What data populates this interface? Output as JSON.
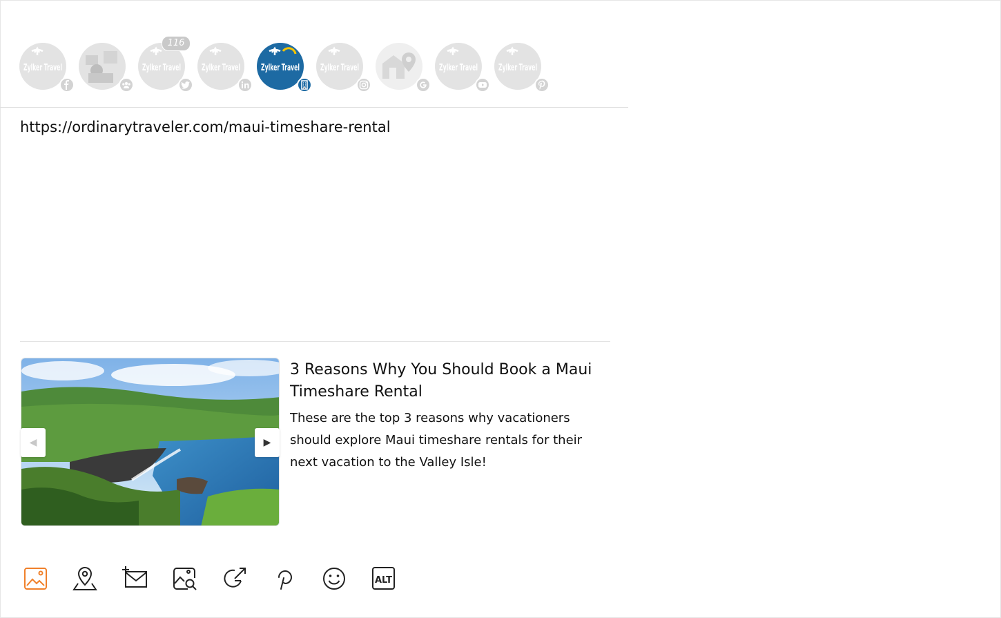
{
  "profiles": [
    {
      "name": "Zylker Travel",
      "network": "facebook",
      "network_icon": "facebook-icon",
      "active": false
    },
    {
      "name": "Zylker Travel",
      "network": "facebook-group",
      "network_icon": "group-icon",
      "active": false
    },
    {
      "name": "Zylker Travel",
      "network": "twitter",
      "network_icon": "twitter-icon",
      "active": false,
      "count": "116"
    },
    {
      "name": "Zylker Travel",
      "network": "linkedin",
      "network_icon": "linkedin-icon",
      "active": false
    },
    {
      "name": "Zylker Travel",
      "network": "linkedin-page",
      "network_icon": "building-icon",
      "active": true
    },
    {
      "name": "Zylker Travel",
      "network": "instagram",
      "network_icon": "instagram-icon",
      "active": false
    },
    {
      "name": "Zylker Travel",
      "network": "google-business",
      "network_icon": "google-icon",
      "active": false
    },
    {
      "name": "Zylker Travel",
      "network": "youtube",
      "network_icon": "youtube-icon",
      "active": false
    },
    {
      "name": "Zylker Travel",
      "network": "pinterest",
      "network_icon": "pinterest-icon",
      "active": false
    }
  ],
  "composer": {
    "message": "https://ordinarytraveler.com/maui-timeshare-rental"
  },
  "link_preview": {
    "title": "3 Reasons Why You Should Book a Maui Timeshare Rental",
    "description": "These are the top 3 reasons why vacationers should explore Maui timeshare rentals for their next vacation to the Valley Isle!",
    "prev_glyph": "◀",
    "next_glyph": "▶"
  },
  "toolbar": {
    "tools": [
      "image-icon",
      "location-pin-icon",
      "add-mail-icon",
      "image-search-icon",
      "share-external-icon",
      "pinterest-icon",
      "emoji-icon",
      "alt-text-icon"
    ],
    "alt_label": "ALT"
  },
  "colors": {
    "accent": "#f0802a",
    "active_profile": "#1d6aa3",
    "inactive_profile": "#e3e3e3"
  }
}
